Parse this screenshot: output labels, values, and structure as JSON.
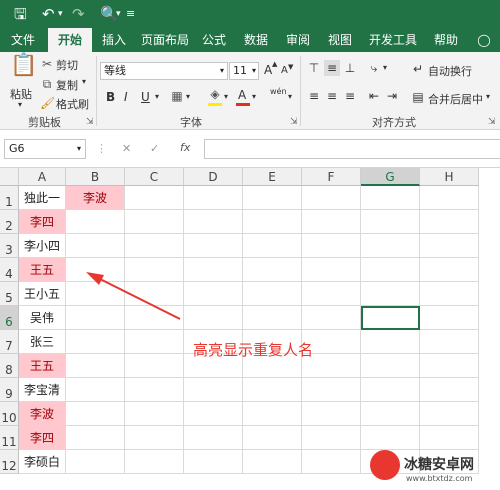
{
  "qat": {
    "save_icon": "save-icon",
    "undo_icon": "undo-icon",
    "redo_icon": "redo-icon",
    "preview_icon": "print-preview-icon",
    "customize_icon": "customize-icon"
  },
  "tabs": [
    "文件",
    "开始",
    "插入",
    "页面布局",
    "公式",
    "数据",
    "审阅",
    "视图",
    "开发工具",
    "帮助"
  ],
  "active_tab": "开始",
  "ribbon": {
    "paste": "粘贴",
    "cut": "剪切",
    "copy": "复制",
    "format_painter": "格式刷",
    "clipboard_group": "剪贴板",
    "font_name": "等线",
    "font_size": "11",
    "grow_font": "A",
    "shrink_font": "A",
    "bold": "B",
    "italic": "I",
    "underline": "U",
    "font_color_letter": "A",
    "wen": "wén",
    "font_group": "字体",
    "wrap_text": "自动换行",
    "merge_center": "合并后居中",
    "alignment_group": "对齐方式"
  },
  "formula_bar": {
    "name_box": "G6",
    "cancel": "✕",
    "enter": "✓",
    "fx": "fx",
    "formula": ""
  },
  "columns": [
    "A",
    "B",
    "C",
    "D",
    "E",
    "F",
    "G",
    "H"
  ],
  "rows": [
    "1",
    "2",
    "3",
    "4",
    "5",
    "6",
    "7",
    "8",
    "9",
    "10",
    "11",
    "12"
  ],
  "cells": {
    "A": [
      "独此一来",
      "李四",
      "李小四",
      "王五",
      "王小五",
      "吴伟",
      "张三",
      "王五",
      "李宝清",
      "李波",
      "李四",
      "李硕白"
    ],
    "B1": "李波"
  },
  "highlighted_A": [
    false,
    true,
    false,
    true,
    false,
    false,
    false,
    true,
    false,
    true,
    true,
    false
  ],
  "selected_cell": "G6",
  "annotation": "高亮显示重复人名",
  "colors": {
    "excel_green": "#217346",
    "highlight_fill": "#ffc7ce",
    "highlight_text": "#9c0006",
    "annotation_red": "#e8372f"
  },
  "watermark": {
    "brand": "冰糖安卓网",
    "url": "www.btxtdz.com"
  }
}
